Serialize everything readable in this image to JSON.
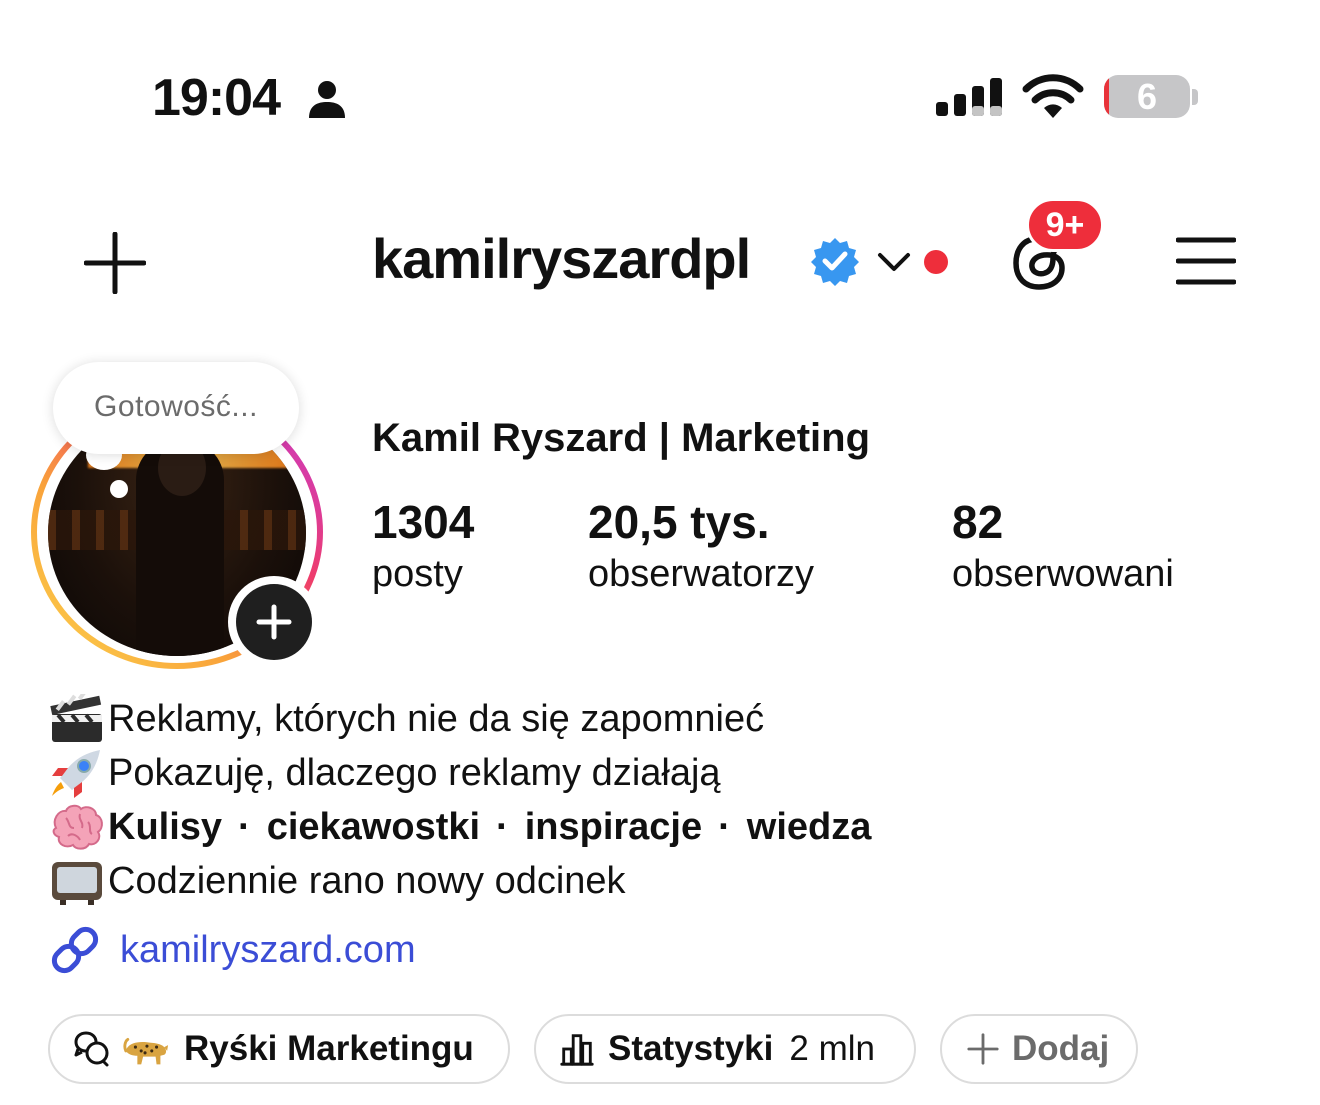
{
  "status_bar": {
    "time": "19:04",
    "battery_level": "6",
    "battery_fraction": 0.06
  },
  "header": {
    "username": "kamilryszardpl",
    "notification_badge": "9+"
  },
  "note": {
    "text": "Gotowość..."
  },
  "profile": {
    "full_name": "Kamil Ryszard | Marketing",
    "stats": [
      {
        "value": "1304",
        "label": "posty"
      },
      {
        "value": "20,5 tys.",
        "label": "obserwatorzy"
      },
      {
        "value": "82",
        "label": "obserwowani"
      }
    ]
  },
  "bio": {
    "line1": "Reklamy, których nie da się zapomnieć",
    "line2": "Pokazuję, dlaczego reklamy działają",
    "line3": [
      "Kulisy",
      "ciekawostki",
      "inspiracje",
      "wiedza"
    ],
    "separator": "·",
    "line4": "Codziennie rano nowy odcinek",
    "link": "kamilryszard.com"
  },
  "chips": {
    "channel": "Ryśki Marketingu",
    "insights_label": "Statystyki",
    "insights_value": "2 mln",
    "add": "Dodaj"
  },
  "colors": {
    "accent_blue": "#3b4dd6",
    "verified_blue": "#3897f0",
    "badge_red": "#ee2e3b"
  }
}
